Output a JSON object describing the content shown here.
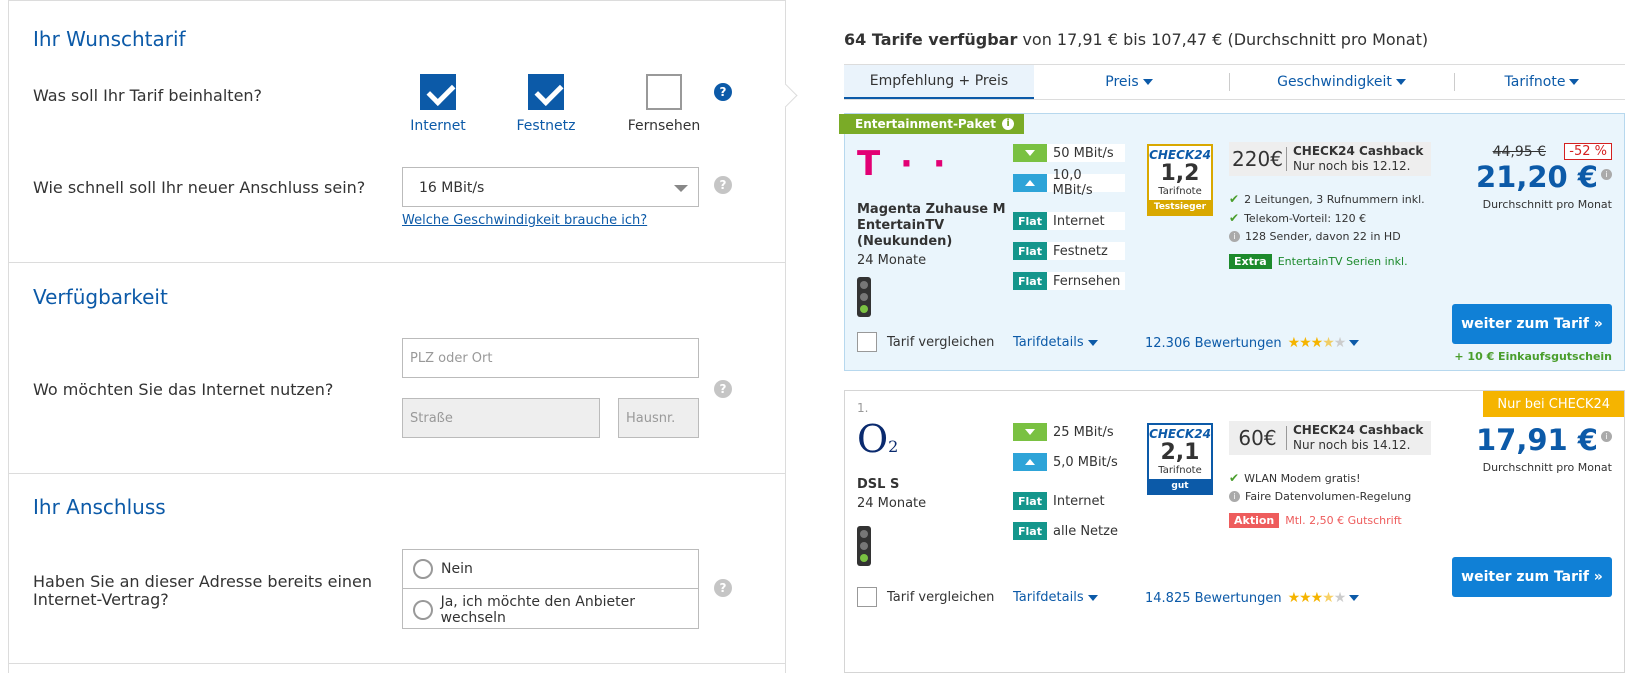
{
  "form": {
    "wunschtarif": {
      "title": "Ihr Wunschtarif",
      "question1": "Was soll Ihr Tarif beinhalten?",
      "options": [
        {
          "label": "Internet",
          "checked": true
        },
        {
          "label": "Festnetz",
          "checked": true
        },
        {
          "label": "Fernsehen",
          "checked": false
        }
      ],
      "question2": "Wie schnell soll Ihr neuer Anschluss sein?",
      "speed_value": "16 MBit/s",
      "speed_link": "Welche Geschwindigkeit brauche ich?"
    },
    "verfuegbarkeit": {
      "title": "Verfügbarkeit",
      "question": "Wo möchten Sie das Internet nutzen?",
      "plz_placeholder": "PLZ oder Ort",
      "street_placeholder": "Straße",
      "number_placeholder": "Hausnr."
    },
    "anschluss": {
      "title": "Ihr Anschluss",
      "question": "Haben Sie an dieser Adresse bereits einen Internet-Vertrag?",
      "options": [
        "Nein",
        "Ja, ich möchte den Anbieter wechseln"
      ]
    },
    "help_glyph": "?"
  },
  "results": {
    "count_bold": "64 Tarife verfügbar",
    "range_text": " von 17,91 € bis 107,47 € (Durchschnitt pro Monat)",
    "sort_tabs": [
      {
        "label": "Empfehlung + Preis",
        "active": true
      },
      {
        "label": "Preis",
        "active": false
      },
      {
        "label": "Geschwindigkeit",
        "active": false
      },
      {
        "label": "Tarifnote",
        "active": false
      }
    ],
    "tariffs": [
      {
        "ribbon": "Entertainment-Paket",
        "rank": "",
        "corner_badge": "",
        "provider_logo": "T · ·",
        "provider_color": "#e20074",
        "name": "Magenta Zuhause M EntertainTV (Neukunden)",
        "term": "24 Monate",
        "download": "50 MBit/s",
        "upload": "10,0 MBit/s",
        "flats": [
          "Internet",
          "Festnetz",
          "Fernsehen"
        ],
        "flat_label": "Flat",
        "seal": {
          "brand": "CHECK24",
          "grade": "1,2",
          "label": "Tarifnote",
          "foot": "Testsieger",
          "color": "#d9a800"
        },
        "cashback_amount": "220€",
        "cashback_title": "CHECK24 Cashback",
        "cashback_note": "Nur noch bis 12.12.",
        "perks": [
          {
            "icon": "check",
            "text": "2 Leitungen, 3 Rufnummern inkl."
          },
          {
            "icon": "check",
            "text": "Telekom-Vorteil: 120 €"
          },
          {
            "icon": "info",
            "text": "128 Sender, davon 22 in HD"
          }
        ],
        "tag": {
          "label": "Extra",
          "text": "EntertainTV Serien inkl.",
          "type": "extra"
        },
        "old_price": "44,95 €",
        "discount": "-52 %",
        "price": "21,20 €",
        "price_sub": "Durchschnitt pro Monat",
        "cta": "weiter zum Tarif »",
        "voucher": "+ 10 € Einkaufsgutschein",
        "compare": "Tarif vergleichen",
        "details": "Tarifdetails",
        "reviews": "12.306 Bewertungen",
        "stars": 3.5
      },
      {
        "ribbon": "",
        "rank": "1.",
        "corner_badge": "Nur bei CHECK24",
        "provider_logo": "O2",
        "provider_color": "#0a2a6e",
        "name": "DSL S",
        "term": "24 Monate",
        "download": "25 MBit/s",
        "upload": "5,0 MBit/s",
        "flats": [
          "Internet",
          "alle Netze"
        ],
        "flat_label": "Flat",
        "seal": {
          "brand": "CHECK24",
          "grade": "2,1",
          "label": "Tarifnote",
          "foot": "gut",
          "color": "#0c5aa8"
        },
        "cashback_amount": "60€",
        "cashback_title": "CHECK24 Cashback",
        "cashback_note": "Nur noch bis 14.12.",
        "perks": [
          {
            "icon": "check",
            "text": "WLAN Modem gratis!"
          },
          {
            "icon": "info",
            "text": "Faire Datenvolumen-Regelung"
          }
        ],
        "tag": {
          "label": "Aktion",
          "text": "Mtl. 2,50 € Gutschrift",
          "type": "aktion"
        },
        "old_price": "",
        "discount": "",
        "price": "17,91 €",
        "price_sub": "Durchschnitt pro Monat",
        "cta": "weiter zum Tarif »",
        "voucher": "",
        "compare": "Tarif vergleichen",
        "details": "Tarifdetails",
        "reviews": "14.825 Bewertungen",
        "stars": 3.5
      }
    ]
  },
  "colors": {
    "accent": "#0c5aa8",
    "cta": "#1080d6",
    "ribbon": "#7aab27",
    "badge": "#f5b400",
    "highlight_bg": "#eaf5fc"
  }
}
